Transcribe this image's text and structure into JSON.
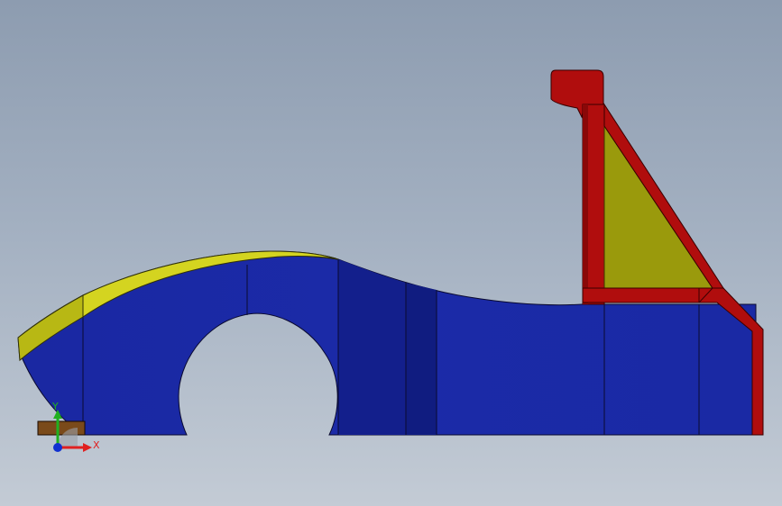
{
  "viewport": {
    "triad": {
      "x_label": "X",
      "y_label": "Y"
    }
  },
  "colors": {
    "body_blue": "#1b2aa8",
    "body_blue_dark": "#131f8a",
    "fender_yellow": "#c8c81a",
    "gusset_olive": "#9a9a0c",
    "frame_red": "#b00d0d",
    "frame_red_dark": "#8a0808",
    "x_axis": "#e02020",
    "y_axis": "#20b020",
    "z_axis": "#1030d0"
  },
  "icons": [
    "coordinate-triad-icon"
  ]
}
